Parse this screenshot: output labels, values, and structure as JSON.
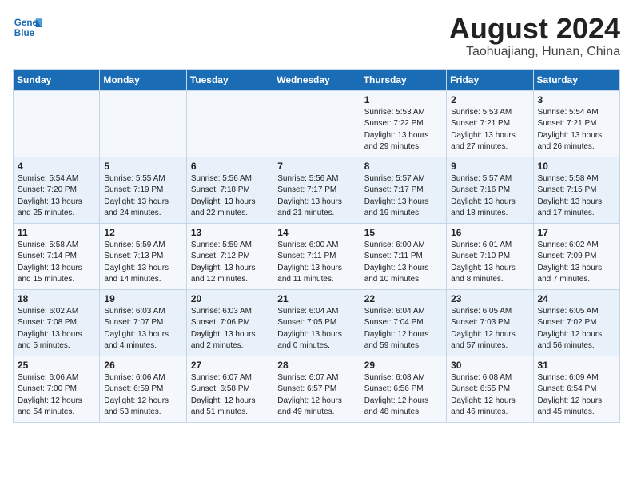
{
  "logo": {
    "line1": "General",
    "line2": "Blue"
  },
  "title": "August 2024",
  "subtitle": "Taohuajiang, Hunan, China",
  "weekdays": [
    "Sunday",
    "Monday",
    "Tuesday",
    "Wednesday",
    "Thursday",
    "Friday",
    "Saturday"
  ],
  "weeks": [
    [
      {
        "day": "",
        "info": ""
      },
      {
        "day": "",
        "info": ""
      },
      {
        "day": "",
        "info": ""
      },
      {
        "day": "",
        "info": ""
      },
      {
        "day": "1",
        "info": "Sunrise: 5:53 AM\nSunset: 7:22 PM\nDaylight: 13 hours\nand 29 minutes."
      },
      {
        "day": "2",
        "info": "Sunrise: 5:53 AM\nSunset: 7:21 PM\nDaylight: 13 hours\nand 27 minutes."
      },
      {
        "day": "3",
        "info": "Sunrise: 5:54 AM\nSunset: 7:21 PM\nDaylight: 13 hours\nand 26 minutes."
      }
    ],
    [
      {
        "day": "4",
        "info": "Sunrise: 5:54 AM\nSunset: 7:20 PM\nDaylight: 13 hours\nand 25 minutes."
      },
      {
        "day": "5",
        "info": "Sunrise: 5:55 AM\nSunset: 7:19 PM\nDaylight: 13 hours\nand 24 minutes."
      },
      {
        "day": "6",
        "info": "Sunrise: 5:56 AM\nSunset: 7:18 PM\nDaylight: 13 hours\nand 22 minutes."
      },
      {
        "day": "7",
        "info": "Sunrise: 5:56 AM\nSunset: 7:17 PM\nDaylight: 13 hours\nand 21 minutes."
      },
      {
        "day": "8",
        "info": "Sunrise: 5:57 AM\nSunset: 7:17 PM\nDaylight: 13 hours\nand 19 minutes."
      },
      {
        "day": "9",
        "info": "Sunrise: 5:57 AM\nSunset: 7:16 PM\nDaylight: 13 hours\nand 18 minutes."
      },
      {
        "day": "10",
        "info": "Sunrise: 5:58 AM\nSunset: 7:15 PM\nDaylight: 13 hours\nand 17 minutes."
      }
    ],
    [
      {
        "day": "11",
        "info": "Sunrise: 5:58 AM\nSunset: 7:14 PM\nDaylight: 13 hours\nand 15 minutes."
      },
      {
        "day": "12",
        "info": "Sunrise: 5:59 AM\nSunset: 7:13 PM\nDaylight: 13 hours\nand 14 minutes."
      },
      {
        "day": "13",
        "info": "Sunrise: 5:59 AM\nSunset: 7:12 PM\nDaylight: 13 hours\nand 12 minutes."
      },
      {
        "day": "14",
        "info": "Sunrise: 6:00 AM\nSunset: 7:11 PM\nDaylight: 13 hours\nand 11 minutes."
      },
      {
        "day": "15",
        "info": "Sunrise: 6:00 AM\nSunset: 7:11 PM\nDaylight: 13 hours\nand 10 minutes."
      },
      {
        "day": "16",
        "info": "Sunrise: 6:01 AM\nSunset: 7:10 PM\nDaylight: 13 hours\nand 8 minutes."
      },
      {
        "day": "17",
        "info": "Sunrise: 6:02 AM\nSunset: 7:09 PM\nDaylight: 13 hours\nand 7 minutes."
      }
    ],
    [
      {
        "day": "18",
        "info": "Sunrise: 6:02 AM\nSunset: 7:08 PM\nDaylight: 13 hours\nand 5 minutes."
      },
      {
        "day": "19",
        "info": "Sunrise: 6:03 AM\nSunset: 7:07 PM\nDaylight: 13 hours\nand 4 minutes."
      },
      {
        "day": "20",
        "info": "Sunrise: 6:03 AM\nSunset: 7:06 PM\nDaylight: 13 hours\nand 2 minutes."
      },
      {
        "day": "21",
        "info": "Sunrise: 6:04 AM\nSunset: 7:05 PM\nDaylight: 13 hours\nand 0 minutes."
      },
      {
        "day": "22",
        "info": "Sunrise: 6:04 AM\nSunset: 7:04 PM\nDaylight: 12 hours\nand 59 minutes."
      },
      {
        "day": "23",
        "info": "Sunrise: 6:05 AM\nSunset: 7:03 PM\nDaylight: 12 hours\nand 57 minutes."
      },
      {
        "day": "24",
        "info": "Sunrise: 6:05 AM\nSunset: 7:02 PM\nDaylight: 12 hours\nand 56 minutes."
      }
    ],
    [
      {
        "day": "25",
        "info": "Sunrise: 6:06 AM\nSunset: 7:00 PM\nDaylight: 12 hours\nand 54 minutes."
      },
      {
        "day": "26",
        "info": "Sunrise: 6:06 AM\nSunset: 6:59 PM\nDaylight: 12 hours\nand 53 minutes."
      },
      {
        "day": "27",
        "info": "Sunrise: 6:07 AM\nSunset: 6:58 PM\nDaylight: 12 hours\nand 51 minutes."
      },
      {
        "day": "28",
        "info": "Sunrise: 6:07 AM\nSunset: 6:57 PM\nDaylight: 12 hours\nand 49 minutes."
      },
      {
        "day": "29",
        "info": "Sunrise: 6:08 AM\nSunset: 6:56 PM\nDaylight: 12 hours\nand 48 minutes."
      },
      {
        "day": "30",
        "info": "Sunrise: 6:08 AM\nSunset: 6:55 PM\nDaylight: 12 hours\nand 46 minutes."
      },
      {
        "day": "31",
        "info": "Sunrise: 6:09 AM\nSunset: 6:54 PM\nDaylight: 12 hours\nand 45 minutes."
      }
    ]
  ]
}
